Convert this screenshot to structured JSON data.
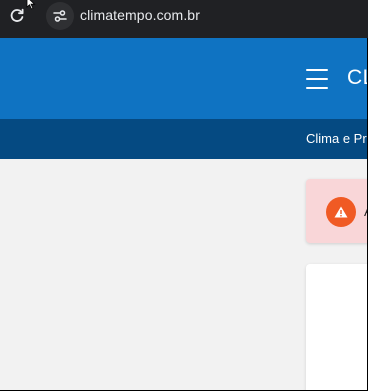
{
  "browser": {
    "url": "climatempo.com.br"
  },
  "header": {
    "logo_text": "CL",
    "background_color": "#0f73c2"
  },
  "subnav": {
    "link_label": "Clima e Pr",
    "background_color": "#054a82"
  },
  "alert": {
    "text": "A",
    "icon": "warning-icon",
    "background_color": "#f9d6d8",
    "icon_color": "#f05a24"
  },
  "icons": {
    "reload": "reload-icon",
    "site_info": "tune-icon",
    "menu": "menu-icon",
    "cursor": "mouse-cursor-icon"
  }
}
